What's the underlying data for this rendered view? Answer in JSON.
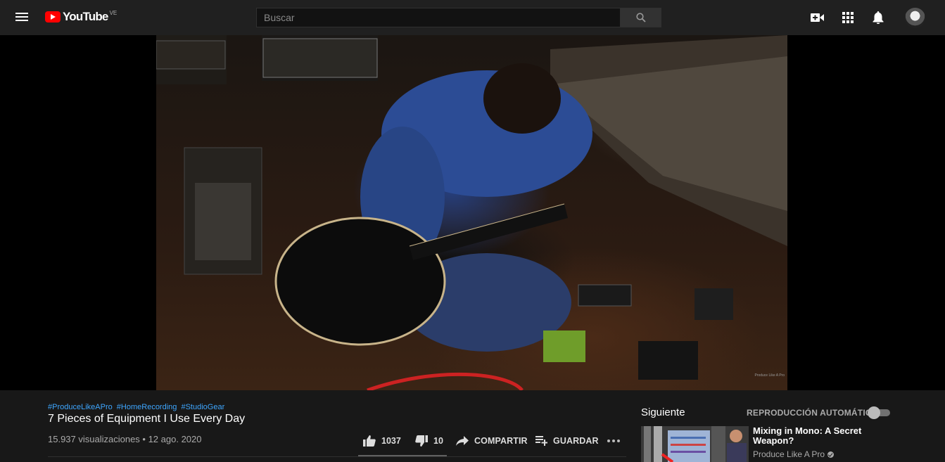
{
  "header": {
    "logo_text": "YouTube",
    "logo_country": "VE",
    "search_placeholder": "Buscar"
  },
  "video": {
    "watermark": "Produce Like A Pro"
  },
  "info": {
    "hashtags": [
      "#ProduceLikeAPro",
      "#HomeRecording",
      "#StudioGear"
    ],
    "title": "7 Pieces of Equipment I Use Every Day",
    "meta": "15.937 visualizaciones • 12 ago. 2020",
    "likes": "1037",
    "dislikes": "10",
    "share_label": "COMPARTIR",
    "save_label": "GUARDAR"
  },
  "sidebar": {
    "up_next_label": "Siguiente",
    "autoplay_label": "REPRODUCCIÓN AUTOMÁTICA",
    "autoplay_on": false,
    "recommendations": [
      {
        "title": "Mixing in Mono: A Secret Weapon?",
        "channel": "Produce Like A Pro"
      }
    ]
  },
  "colors": {
    "header_bg": "#202020",
    "page_bg": "#181818",
    "link": "#3ea6ff",
    "brand_red": "#ff0000"
  }
}
